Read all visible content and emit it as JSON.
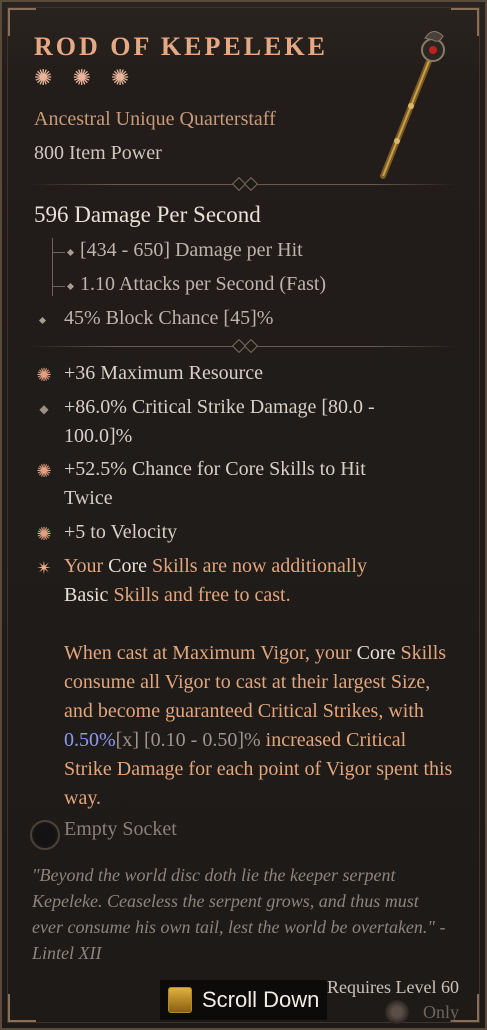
{
  "item": {
    "name": "ROD OF KEPELEKE",
    "type_line": "Ancestral Unique Quarterstaff",
    "item_power": "800 Item Power",
    "dps": "596 Damage Per Second",
    "damage_per_hit": "[434 - 650] Damage per Hit",
    "attacks_per_second": "1.10 Attacks per Second (Fast)",
    "block_chance": "45% Block Chance [45]%",
    "affixes": [
      {
        "icon": "greater-affix-star-icon",
        "lines": [
          "+36 Maximum Resource"
        ]
      },
      {
        "icon": "affix-diamond-icon",
        "lines": [
          "+86.0% Critical Strike Damage [80.0 -",
          "100.0]%"
        ]
      },
      {
        "icon": "greater-affix-star-icon",
        "lines": [
          "+52.5% Chance for Core Skills to Hit",
          "Twice"
        ]
      },
      {
        "icon": "greater-affix-star-icon",
        "lines": [
          "+5 to Velocity"
        ]
      }
    ],
    "unique_power": {
      "p1_a": "Your ",
      "p1_b": "Core",
      "p1_c": " Skills are now additionally",
      "p1_d": "Basic",
      "p1_e": " Skills and free to cast.",
      "p2_a": "When cast at Maximum Vigor, your ",
      "p2_b": "Core",
      "p2_c": " Skills consume all Vigor to cast at their largest Size, and become guaranteed Critical Strikes, with ",
      "p2_value": "0.50%",
      "p2_x": "[x]",
      "p2_range": " [0.10 - 0.50]%",
      "p2_d": " increased Critical Strike Damage for each point of Vigor spent this way."
    },
    "socket": "Empty Socket",
    "flavor": "\"Beyond the world disc doth lie the keeper serpent Kepeleke. Ceaseless the serpent grows, and thus must ever consume his own tail, lest the world be overtaken.\" - Lintel XII",
    "requires": "Requires Level 60",
    "only": "Only"
  },
  "ui": {
    "scroll_label": "Scroll Down"
  },
  "colors": {
    "name": "#e7a983",
    "unique_text": "#e3a57c",
    "value_blue": "#8e9bf0"
  }
}
